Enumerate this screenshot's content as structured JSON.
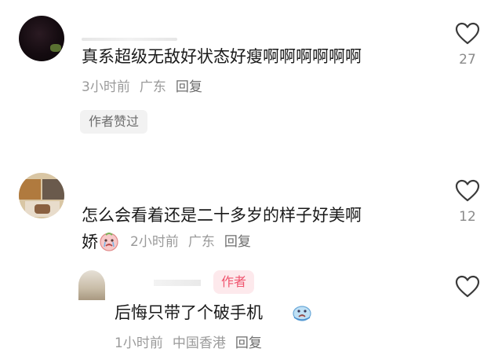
{
  "comments": [
    {
      "text": "真系超级无敌好状态好瘦啊啊啊啊啊啊",
      "time": "3小时前",
      "location": "广东",
      "reply_label": "回复",
      "chip": "作者赞过",
      "likes": "27"
    },
    {
      "text_line1": "怎么会看着还是二十多岁的样子好美啊",
      "text_line2": "娇",
      "emoji": "crying-face-emoji",
      "time": "2小时前",
      "location": "广东",
      "reply_label": "回复",
      "likes": "12"
    }
  ],
  "reply": {
    "author_badge": "作者",
    "text": "后悔只带了个破手机",
    "emoji": "crying-face-emoji",
    "time": "1小时前",
    "location": "中国香港",
    "reply_label": "回复"
  },
  "colors": {
    "badge_text": "#f0546e",
    "badge_bg": "#fde9ec",
    "meta": "#9a9a9a"
  }
}
